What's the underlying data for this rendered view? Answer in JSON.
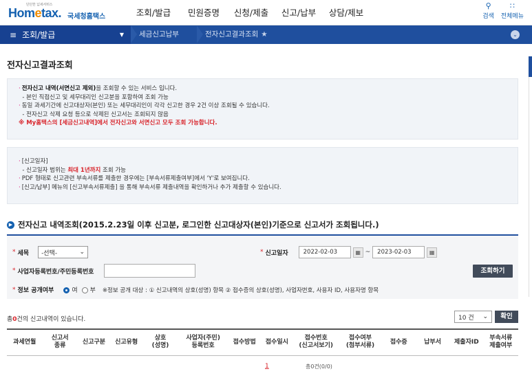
{
  "header": {
    "logo_sub": "단단한 납세서비스",
    "logo_main_a": "Hom",
    "logo_main_dot": "e",
    "logo_main_b": "tax.",
    "logo_kr": "국세청홈택스",
    "nav": [
      "조회/발급",
      "민원증명",
      "신청/제출",
      "신고/납부",
      "상담/제보"
    ],
    "search_label": "검색",
    "menu_label": "전체메뉴"
  },
  "location": {
    "menu_title": "조회/발급",
    "crumb1": "세금신고납부",
    "crumb2": "전자신고결과조회"
  },
  "page_title": "전자신고결과조회",
  "info1": {
    "line1_bold": "전자신고 내역(서면신고 제외)",
    "line1_rest": "을 조회할 수 있는 서비스 입니다.",
    "line2": "- 본인 직접신고 및 세무대리인 신고분을 포함하여 조회 가능",
    "line3": "동일 과세기간에 신고대상자(본인) 또는 세무대리인이 각각 신고한 경우 2건 이상 조회될 수 있습니다.",
    "line4": "- 전자신고 삭제 요청 등으로 삭제된 신고서는 조회되지 않음",
    "line5": "※ My홈택스의 [세금신고내역]에서 전자신고와 서면신고 모두 조회 가능합니다."
  },
  "info2": {
    "line1": "[신고일자]",
    "line2_a": "- 신고일자 범위는 ",
    "line2_red": "최대 1년까지",
    "line2_b": " 조회 가능",
    "line3": "PDF 형태로 신고관련 부속서류를 제출한 경우에는 [부속서류제출여부]에서 'Y'로 보여집니다.",
    "line4": "[신고/납부] 메뉴의 [신고부속서류제출] 을 통해 부속서류 제출내역을 확인하거나 추가 제출할 수 있습니다."
  },
  "section_title": "전자신고 내역조회(2015.2.23일 이후 신고분, 로그인한  신고대상자(본인)기준으로  신고서가 조회됩니다.)",
  "search": {
    "tax_label": "세목",
    "tax_value": "-선택-",
    "date_label": "신고일자",
    "date_from": "2022-02-03",
    "date_sep": "~",
    "date_to": "2023-02-03",
    "bizno_label": "사업자등록번호/주민등록번호",
    "search_button": "조회하기",
    "disclose_label": "정보 공개여부",
    "yes_label": "여",
    "no_label": "부",
    "disclose_note": "※정보 공개 대상 : ① 신고내역의 상호(성명) 항목 ② 접수증의 상호(성명), 사업자번호, 사용자 ID, 사용자명 항목"
  },
  "result": {
    "count_prefix": "총",
    "count_num": "0",
    "count_suffix": "건의 신고내역이 있습니다.",
    "page_size": "10 건",
    "confirm_button": "확인",
    "columns": [
      "과세연월",
      "신고서\n종류",
      "신고구분",
      "신고유형",
      "상호\n(성명)",
      "사업자(주민)\n등록번호",
      "접수방법",
      "접수일시",
      "접수번호\n(신고서보기)",
      "접수여부\n(첨부서류)",
      "접수증",
      "납부서",
      "제출자ID",
      "부속서류\n제출여부"
    ],
    "page_current": "1",
    "page_info": "총0건(0/0)"
  }
}
